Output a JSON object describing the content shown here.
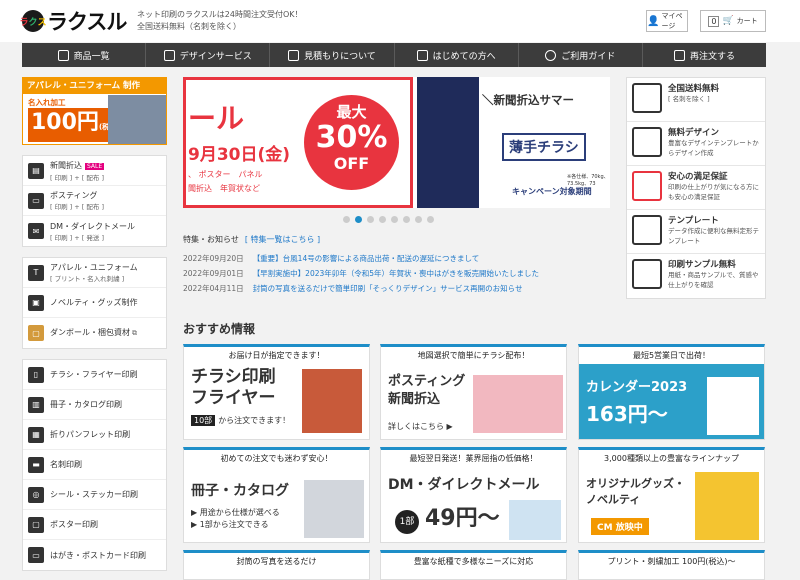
{
  "header": {
    "logo_text": "ラクスル",
    "tagline_1": "ネット印刷のラクスルは24時間注文受付OK！",
    "tagline_2": "全国送料無料（名刺を除く）",
    "mypage": "マイページ",
    "cart": "カート",
    "cart_count": "0"
  },
  "nav": [
    {
      "label": "商品一覧",
      "icon": "grid-icon"
    },
    {
      "label": "デザインサービス",
      "icon": "pen-icon"
    },
    {
      "label": "見積もりについて",
      "icon": "document-icon"
    },
    {
      "label": "はじめての方へ",
      "icon": "book-icon"
    },
    {
      "label": "ご利用ガイド",
      "icon": "question-icon"
    },
    {
      "label": "再注文する",
      "icon": "reorder-icon"
    }
  ],
  "apparel": {
    "heading": "アパレル・ユニフォーム 制作",
    "subheading": "名入れ加工",
    "price": "100円",
    "price_note": "(税込)〜"
  },
  "sidebar_group1": [
    {
      "label": "新聞折込",
      "sub": "[ 印刷 ] + [ 配布 ]",
      "badge": "SALE"
    },
    {
      "label": "ポスティング",
      "sub": "[ 印刷 ] + [ 配布 ]"
    },
    {
      "label": "DM・ダイレクトメール",
      "sub": "[ 印刷 ] + [ 発送 ]"
    }
  ],
  "sidebar_group2": [
    {
      "label": "アパレル・ユニフォーム",
      "sub": "[ プリント・名入れ刺繍 ]"
    },
    {
      "label": "ノベルティ・グッズ制作",
      "sub": ""
    },
    {
      "label": "ダンボール・梱包資材",
      "sub": "",
      "ext": "⧉"
    }
  ],
  "sidebar_group3": [
    {
      "label": "チラシ・フライヤー印刷"
    },
    {
      "label": "冊子・カタログ印刷"
    },
    {
      "label": "折りパンフレット印刷"
    },
    {
      "label": "名刺印刷"
    },
    {
      "label": "シール・ステッカー印刷"
    },
    {
      "label": "ポスター印刷"
    },
    {
      "label": "はがき・ポストカード印刷"
    }
  ],
  "slide1": {
    "title": "ール",
    "date": "9月30日(金)",
    "cats1": "、 ポスター　パネル",
    "cats2": "聞折込　年賀状など",
    "circle_l1": "最大",
    "circle_l2": "30%",
    "circle_l3": "OFF"
  },
  "slide2": {
    "heading": "＼新聞折込サマー",
    "box": "薄手チラシ",
    "small": "※各仕様、70kg、73.5kg、73",
    "campaign": "キャンペーン対象期間"
  },
  "news": {
    "heading": "特集・お知らせ",
    "link": "[ 特集一覧はこちら ]",
    "items": [
      {
        "date": "2022年09月20日",
        "title": "【重要】台風14号の影響による商品出荷・配送の遅延につきまして"
      },
      {
        "date": "2022年09月01日",
        "title": "【早割実施中】2023年卯年（令和5年）年賀状・喪中はがきを販売開始いたしました"
      },
      {
        "date": "2022年04月11日",
        "title": "封筒の写真を送るだけで簡単印刷「そっくりデザイン」サービス再開のお知らせ"
      }
    ]
  },
  "recommend_title": "おすすめ情報",
  "cards": [
    {
      "top": "お届け日が指定できます！",
      "title": "チラシ印刷\nフライヤー",
      "note": "10部から注文できます！",
      "note_tag": "10部"
    },
    {
      "top": "地図選択で簡単にチラシ配布！",
      "title": "ポスティング\n新聞折込",
      "note": "詳しくはこちら ▶"
    },
    {
      "top": "最短5営業日で出荷！",
      "title": "カレンダー2023",
      "note": "163円〜"
    },
    {
      "top": "初めての注文でも迷わず安心！",
      "title": "冊子・カタログ",
      "note1": "▶ 用途から仕様が選べる",
      "note2": "▶ 1部から注文できる"
    },
    {
      "top": "最短翌日発送！業界屈指の低価格！",
      "title": "DM・ダイレクトメール",
      "note_tag": "1部",
      "note": "49円〜"
    },
    {
      "top": "3,000種類以上の豊富なラインナップ",
      "title": "オリジナルグッズ・\nノベルティ",
      "note": "CM 放映中"
    },
    {
      "top": "封筒の写真を送るだけ",
      "title": "",
      "note": ""
    },
    {
      "top": "豊富な紙種で多様なニーズに対応",
      "title": "",
      "note": ""
    },
    {
      "top": "プリント・刺繍加工 100円(税込)〜",
      "title": "",
      "note": ""
    }
  ],
  "right_items": [
    {
      "title": "全国送料無料",
      "desc": "[ 名刺を除く ]",
      "icon": "truck-icon"
    },
    {
      "title": "無料デザイン",
      "desc": "豊富なデザインテンプレートからデザイン作成",
      "icon": "design-icon"
    },
    {
      "title": "安心の満足保証",
      "desc": "印刷の仕上がりが気になる方にも安心の満足保証",
      "icon": "heart-hand-icon"
    },
    {
      "title": "テンプレート",
      "desc": "データ作成に便利な無料定形テンプレート",
      "icon": "template-icon"
    },
    {
      "title": "印刷サンプル無料",
      "desc": "用紙・商品サンプルで、質感や仕上がりを確認",
      "icon": "sample-icon"
    }
  ],
  "colors": {
    "accent": "#e8343f",
    "nav_bg": "#3c3c3c",
    "link": "#1e78c8",
    "dot_active": "#1e8ec8"
  }
}
